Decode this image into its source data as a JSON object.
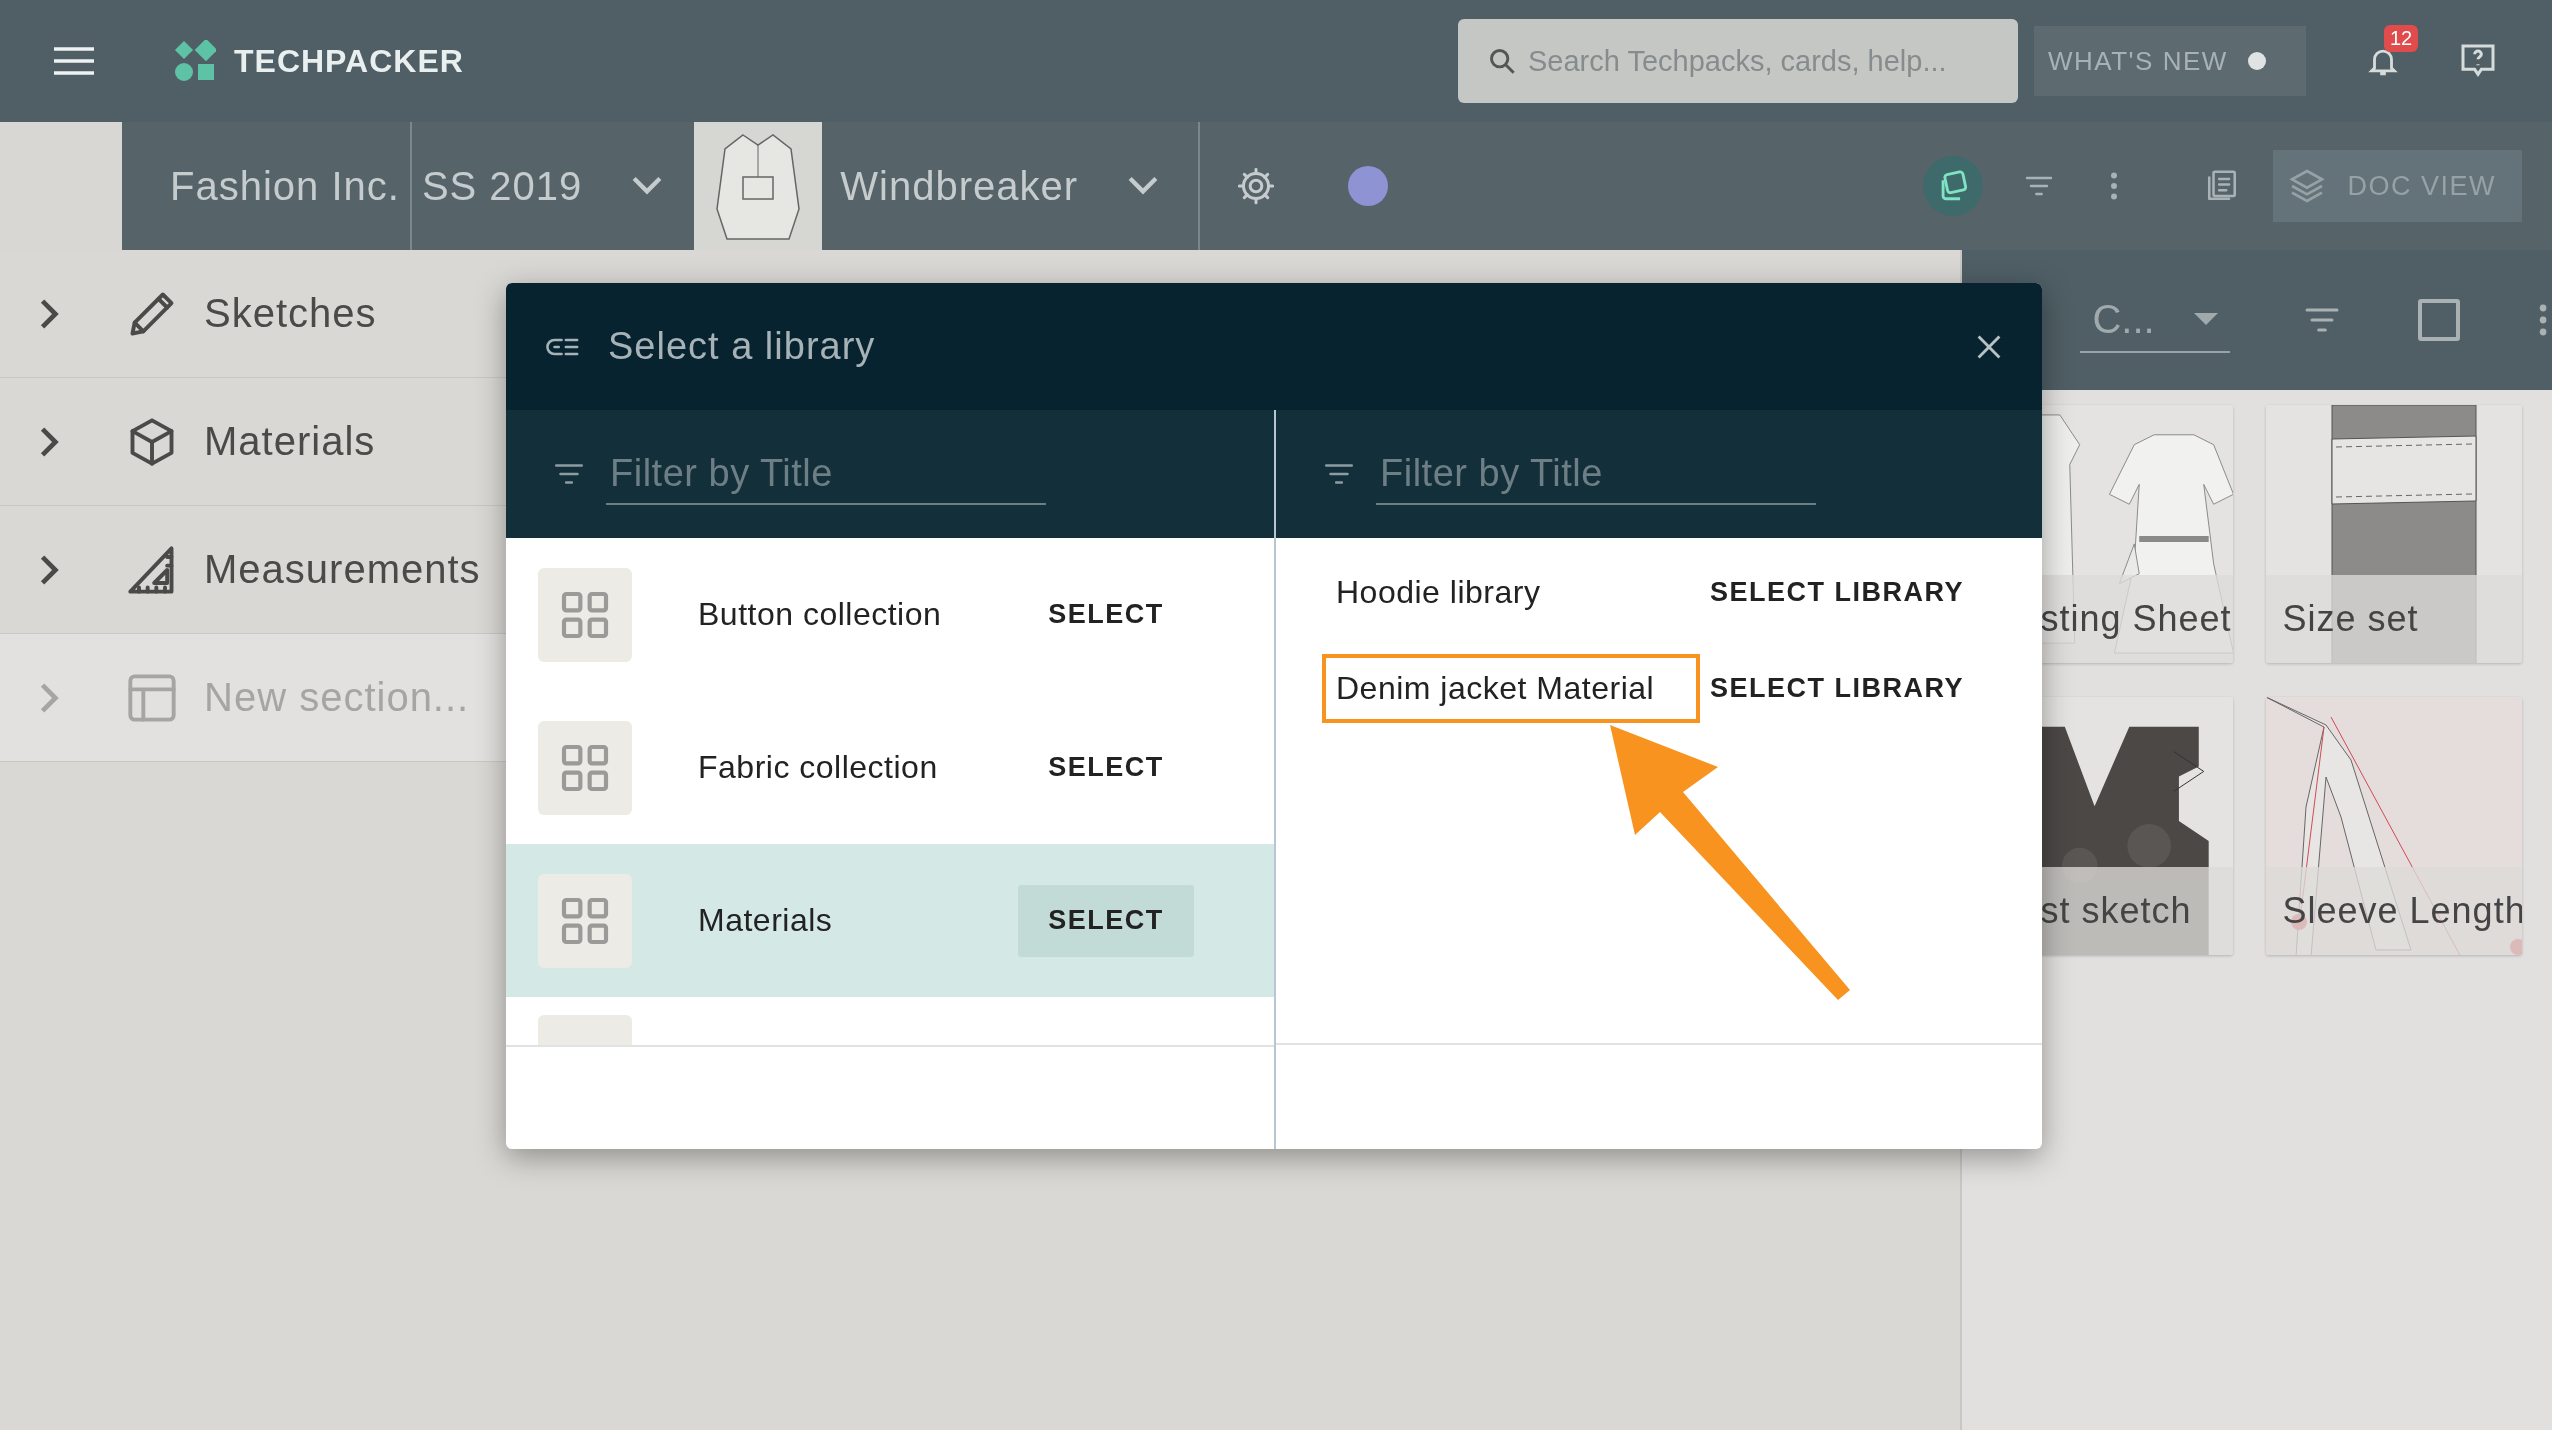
{
  "top_bar": {
    "brand": "TECHPACKER",
    "search": {
      "placeholder": "Search Techpacks, cards, help..."
    },
    "whats_new": "WHAT'S NEW",
    "notifications": "12"
  },
  "breadcrumb": {
    "company": "Fashion Inc.",
    "season": "SS 2019",
    "product": "Windbreaker",
    "doc_view": "DOC VIEW"
  },
  "sidebar": {
    "items": [
      {
        "label": "Sketches",
        "kind": "pencil",
        "disabled": false
      },
      {
        "label": "Materials",
        "kind": "cube",
        "disabled": false
      },
      {
        "label": "Measurements",
        "kind": "ruler",
        "disabled": false
      },
      {
        "label": "New section...",
        "kind": "layout",
        "disabled": true
      }
    ]
  },
  "right_panel": {
    "dropdown": "C...",
    "checked": false,
    "cards": [
      {
        "title": "sting Sheet",
        "kind": "dress"
      },
      {
        "title": "Size set",
        "kind": "band"
      },
      {
        "title": "st sketch",
        "kind": "vest"
      },
      {
        "title": "Sleeve Length",
        "kind": "sleeve"
      }
    ]
  },
  "modal": {
    "title": "Select a library",
    "left": {
      "filter": {
        "placeholder": "Filter by Title"
      },
      "items": [
        {
          "title": "Button collection",
          "action": "SELECT",
          "selected": false
        },
        {
          "title": "Fabric collection",
          "action": "SELECT",
          "selected": false
        },
        {
          "title": "Materials",
          "action": "SELECT",
          "selected": true
        }
      ]
    },
    "right": {
      "filter": {
        "placeholder": "Filter by Title"
      },
      "items": [
        {
          "title": "Hoodie library",
          "action": "SELECT LIBRARY",
          "highlighted": false
        },
        {
          "title": "Denim jacket Material",
          "action": "SELECT LIBRARY",
          "highlighted": true
        }
      ]
    }
  }
}
